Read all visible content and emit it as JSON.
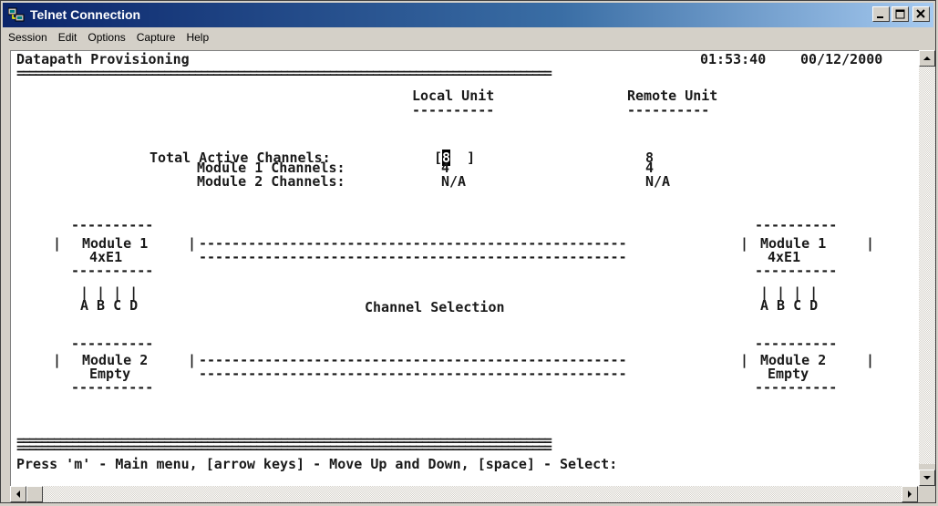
{
  "window": {
    "title": "Telnet Connection"
  },
  "menubar": {
    "items": [
      "Session",
      "Edit",
      "Options",
      "Capture",
      "Help"
    ]
  },
  "terminal": {
    "header_title": "Datapath Provisioning",
    "time": "01:53:40",
    "date": "00/12/2000",
    "rule": "=======================================================================================",
    "col_local": "Local Unit",
    "col_remote": "Remote Unit",
    "col_underline": "----------",
    "rows": [
      {
        "label": "Total Active Channels:",
        "local": "8",
        "remote": "8"
      },
      {
        "label": "Module 1 Channels:",
        "local": "4",
        "remote": "4"
      },
      {
        "label": "Module 2 Channels:",
        "local": "N/A",
        "remote": "N/A"
      }
    ],
    "box_border": "----------",
    "module1_label": "Module 1",
    "module1_type": "4xE1",
    "module2_label": "Module 2",
    "module2_type": "Empty",
    "link_line": "----------------------------------------------------",
    "channel_letters": "A B C D",
    "channel_selection": "Channel Selection",
    "footer": "Press 'm' - Main menu, [arrow keys] - Move Up and Down, [space] - Select:"
  }
}
